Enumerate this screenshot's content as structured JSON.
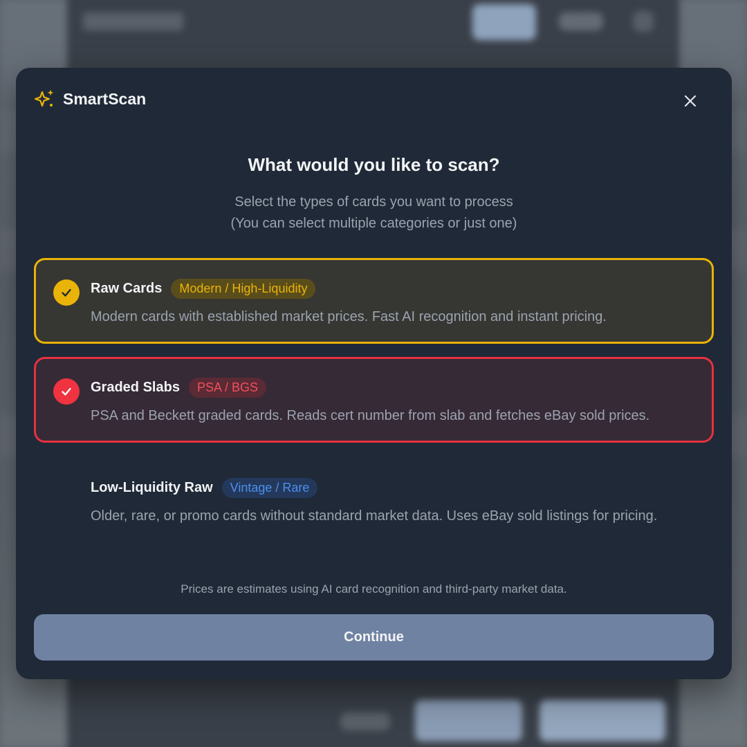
{
  "app": {
    "name": "SmartScan"
  },
  "dialog": {
    "heading": "What would you like to scan?",
    "subtitle_line1": "Select the types of cards you want to process",
    "subtitle_line2": "(You can select multiple categories or just one)",
    "close_icon": "close-icon"
  },
  "options": [
    {
      "title": "Raw Cards",
      "badge": "Modern / High-Liquidity",
      "description": "Modern cards with established market prices. Fast AI recognition and instant pricing.",
      "selected": true,
      "accent": "#eab308"
    },
    {
      "title": "Graded Slabs",
      "badge": "PSA / BGS",
      "description": "PSA and Beckett graded cards. Reads cert number from slab and fetches eBay sold prices.",
      "selected": true,
      "accent": "#ef3340"
    },
    {
      "title": "Low-Liquidity Raw",
      "badge": "Vintage / Rare",
      "description": "Older, rare, or promo cards without standard market data. Uses eBay sold listings for pricing.",
      "selected": false,
      "accent": "#4d8ff0"
    }
  ],
  "footer": {
    "disclaimer": "Prices are estimates using AI card recognition and third-party market data.",
    "continue_label": "Continue"
  }
}
